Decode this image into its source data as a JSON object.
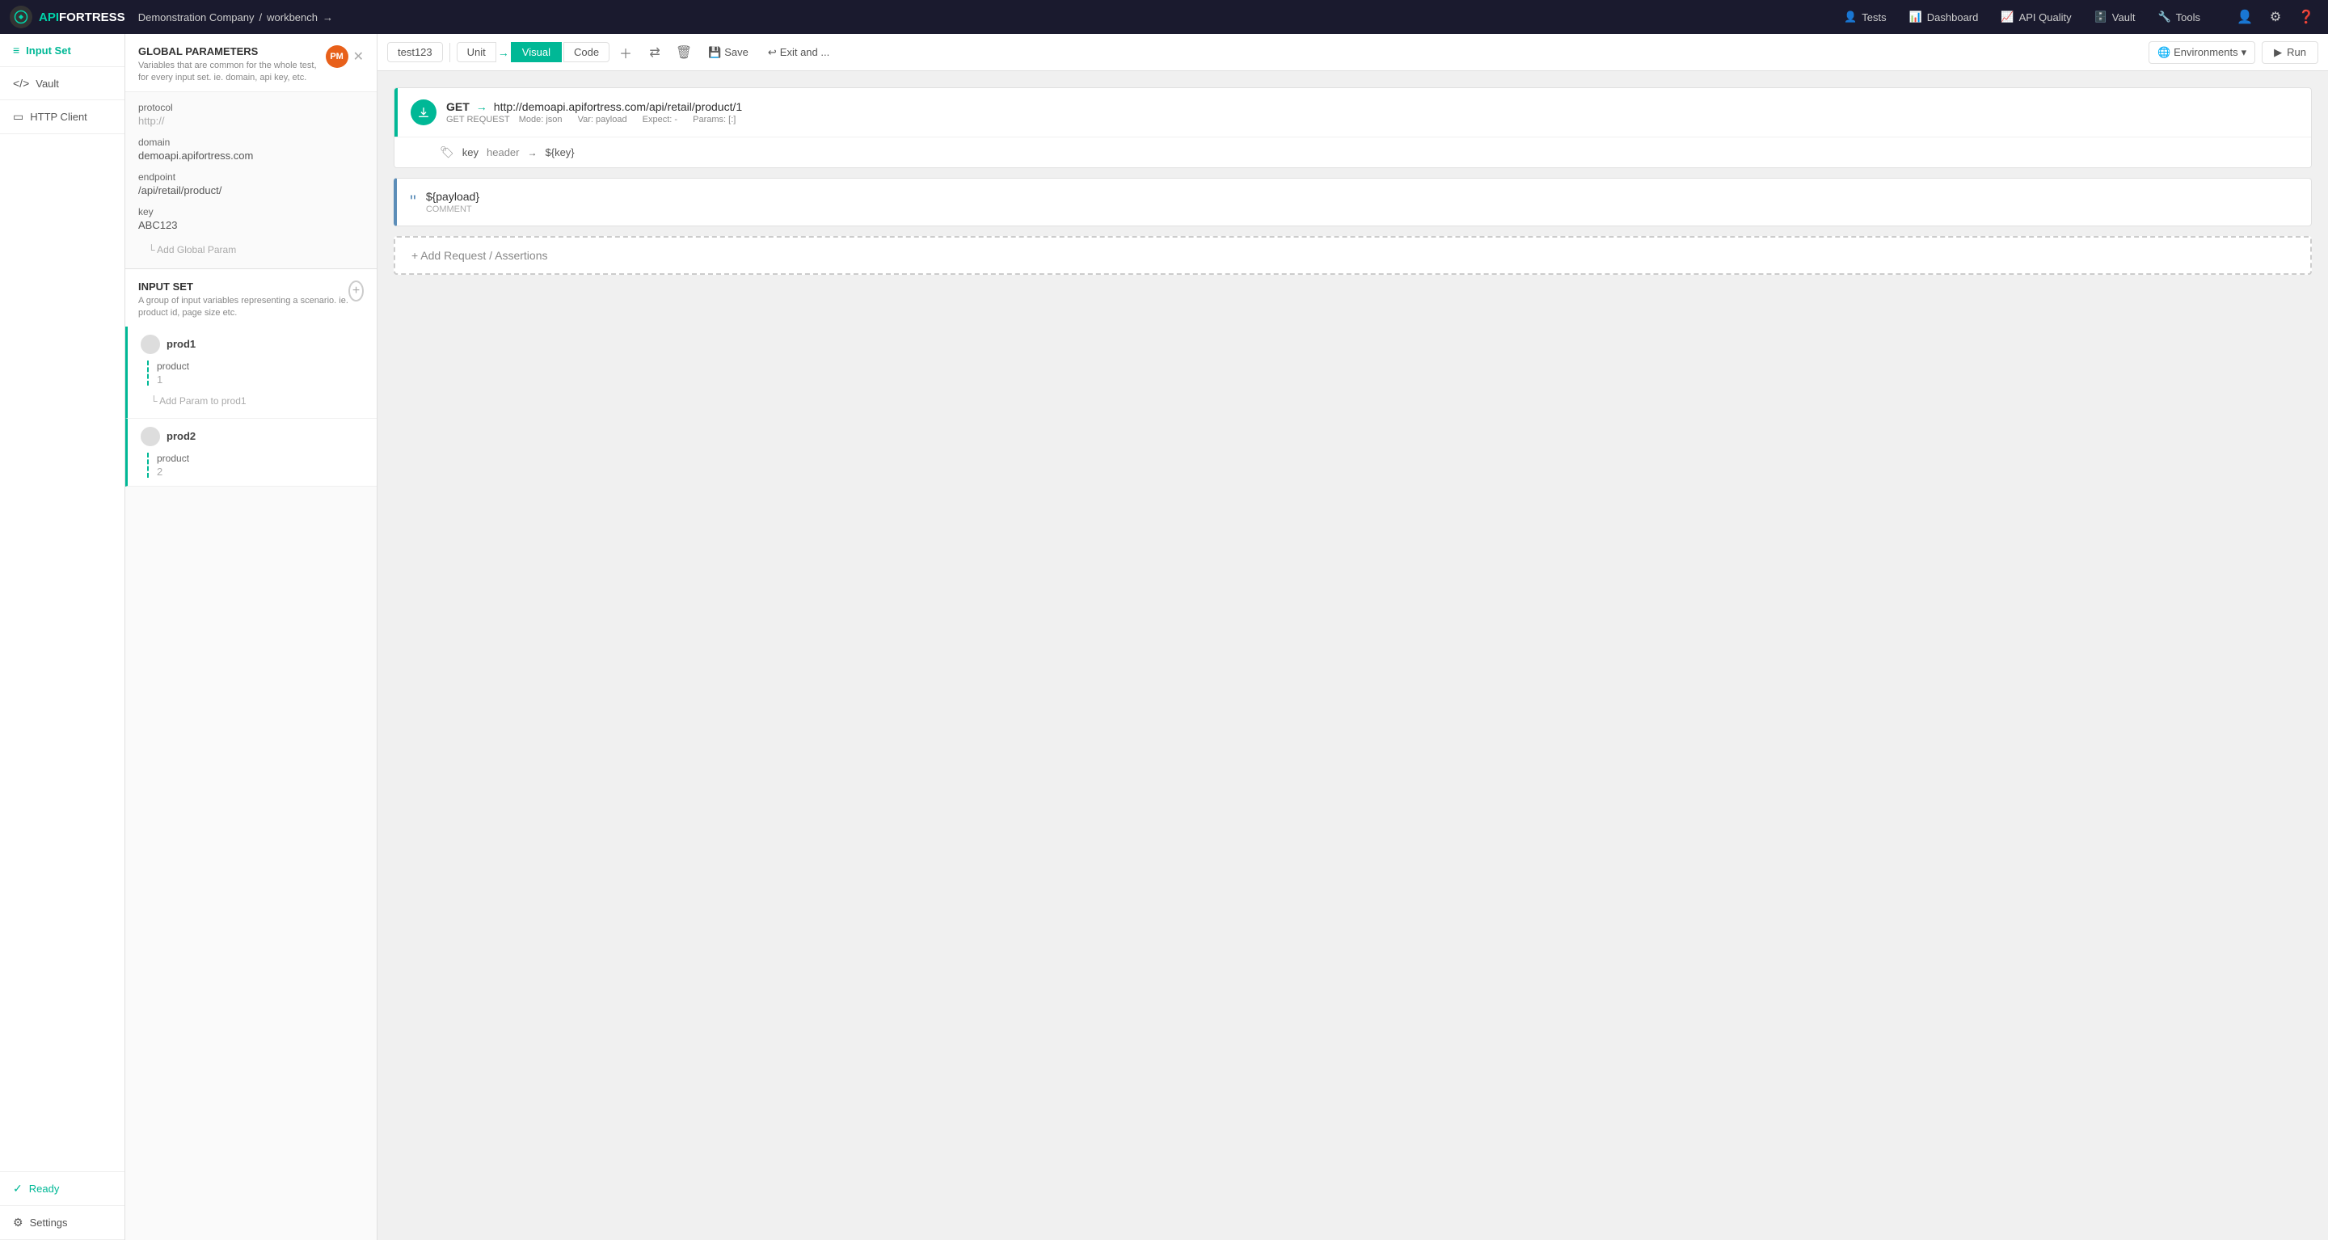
{
  "app": {
    "logo_api": "API",
    "logo_fortress": "FORTRESS",
    "brand_color": "#00d4aa"
  },
  "nav": {
    "breadcrumb_company": "Demonstration Company",
    "breadcrumb_sep": "/",
    "breadcrumb_workbench": "workbench",
    "arrow": "→",
    "links": [
      {
        "id": "tests",
        "icon": "👤",
        "label": "Tests"
      },
      {
        "id": "dashboard",
        "icon": "📊",
        "label": "Dashboard"
      },
      {
        "id": "api-quality",
        "icon": "📈",
        "label": "API Quality"
      },
      {
        "id": "vault",
        "icon": "🗄️",
        "label": "Vault"
      },
      {
        "id": "tools",
        "icon": "🔧",
        "label": "Tools"
      }
    ]
  },
  "sidebar": {
    "items": [
      {
        "id": "input-set",
        "label": "Input Set",
        "icon": "≡",
        "active": true
      },
      {
        "id": "vault",
        "label": "Vault",
        "icon": "</>"
      },
      {
        "id": "http-client",
        "label": "HTTP Client",
        "icon": "▭"
      }
    ],
    "bottom_items": [
      {
        "id": "ready",
        "label": "Ready",
        "icon": "✓"
      },
      {
        "id": "settings",
        "label": "Settings",
        "icon": "⚙"
      }
    ]
  },
  "global_params": {
    "title": "GLOBAL PARAMETERS",
    "description": "Variables that are common for the whole test, for every input set. ie. domain, api key, etc.",
    "avatar_initials": "PM",
    "params": [
      {
        "label": "protocol",
        "value": "http://",
        "filled": false
      },
      {
        "label": "domain",
        "value": "demoapi.apifortress.com",
        "filled": true
      },
      {
        "label": "endpoint",
        "value": "/api/retail/product/",
        "filled": true
      },
      {
        "label": "key",
        "value": "ABC123",
        "filled": true
      }
    ],
    "add_param_label": "└ Add Global Param"
  },
  "input_set": {
    "title": "INPUT SET",
    "description": "A group of input variables representing a scenario. ie. product id, page size etc.",
    "sets": [
      {
        "id": "prod1",
        "name": "prod1",
        "params": [
          {
            "label": "product",
            "value": "1"
          }
        ],
        "add_param_label": "└ Add Param to prod1"
      },
      {
        "id": "prod2",
        "name": "prod2",
        "params": [
          {
            "label": "product",
            "value": "2"
          }
        ]
      }
    ]
  },
  "toolbar": {
    "test_tab": "test123",
    "tab_unit": "Unit",
    "tab_visual": "Visual",
    "tab_code": "Code",
    "save_label": "Save",
    "exit_label": "Exit and ...",
    "environments_label": "Environments",
    "run_label": "Run"
  },
  "canvas": {
    "request": {
      "method": "GET",
      "url": "http://demoapi.apifortress.com/api/retail/product/1",
      "label": "GET REQUEST",
      "mode": "json",
      "var": "payload",
      "expect": "-",
      "params": "[:]",
      "header": {
        "key": "key",
        "type": "header",
        "value": "${key}"
      }
    },
    "comment": {
      "text": "${payload}",
      "label": "COMMENT"
    },
    "add_request_label": "+ Add Request / Assertions"
  }
}
